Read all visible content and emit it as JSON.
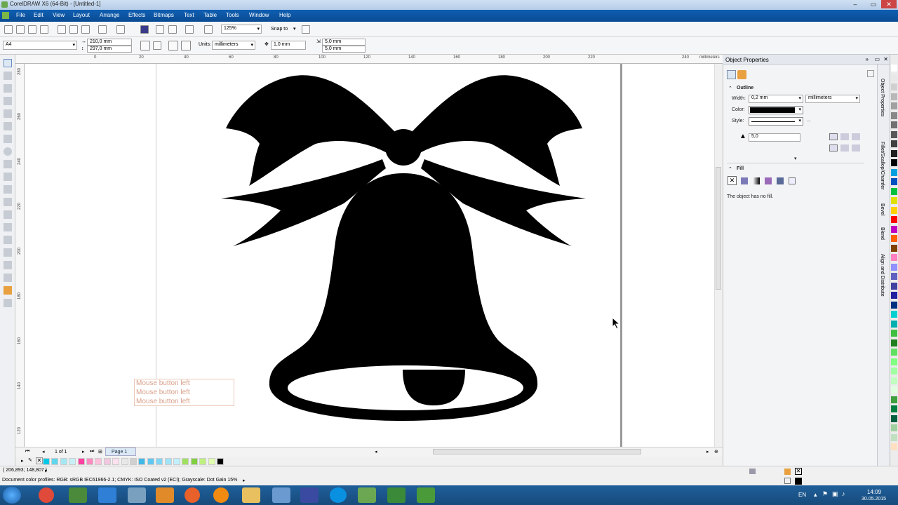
{
  "title": "CorelDRAW X6 (64-Bit) - [Untitled-1]",
  "menu": [
    "File",
    "Edit",
    "View",
    "Layout",
    "Arrange",
    "Effects",
    "Bitmaps",
    "Text",
    "Table",
    "Tools",
    "Window",
    "Help"
  ],
  "toolbar": {
    "zoom": "125%",
    "snap": "Snap to"
  },
  "propbar": {
    "page_size": "A4",
    "width": "210,0 mm",
    "height": "297,0 mm",
    "units_label": "Units:",
    "units": "millimeters",
    "nudge": "1,0 mm",
    "dup_x": "5,0 mm",
    "dup_y": "5,0 mm"
  },
  "ruler": {
    "unit": "millimeters",
    "top_ticks": [
      "0",
      "20",
      "40",
      "60",
      "80",
      "100",
      "120",
      "140",
      "160",
      "180",
      "200",
      "220",
      "240"
    ],
    "left_ticks": [
      "280",
      "260",
      "240",
      "220",
      "200",
      "180",
      "160",
      "140",
      "120"
    ]
  },
  "tooltip": [
    "Mouse button left",
    "Mouse button left",
    "Mouse button left"
  ],
  "pagenav": {
    "count": "1 of 1",
    "page_tab": "Page 1"
  },
  "status": {
    "coords": "( 206,893; 148,807 )",
    "profiles": "Document color profiles: RGB: sRGB IEC61966-2.1; CMYK: ISO Coated v2 (ECI); Grayscale: Dot Gain 15%"
  },
  "docker": {
    "title": "Object Properties",
    "outline": {
      "heading": "Outline",
      "width_label": "Width:",
      "width_value": "0,2 mm",
      "width_units": "millimeters",
      "color_label": "Color:",
      "style_label": "Style:",
      "miter": "5,0",
      "more": "..."
    },
    "fill": {
      "heading": "Fill",
      "message": "The object has no fill."
    },
    "side_tabs": [
      "Object Properties",
      "Fillet/Scallop/Chamfer",
      "Bevel",
      "Blend",
      "Align and Distribute"
    ]
  },
  "taskbar": {
    "lang": "EN",
    "time": "14:09",
    "date": "30.05.2015"
  },
  "colors": {
    "accent": "#0a4b92",
    "palette": [
      "#00c8e6",
      "#5fd7ee",
      "#a5e8f3",
      "#c8f0f7",
      "#ff3fa0",
      "#ff8ac0",
      "#ffc0dc",
      "#f2c7e0",
      "#ffe0ef",
      "#e8e8e8",
      "#d0d0d0",
      "#3fb8e8",
      "#5fc8f0",
      "#7fd6f5",
      "#9fe4fa",
      "#c0f0ff",
      "#a0e060",
      "#80d040",
      "#c0f080",
      "#e0ffb0",
      "#000000"
    ],
    "strip": [
      "#ffffff",
      "#e8e8e8",
      "#d0d0d0",
      "#b8b8b8",
      "#a0a0a0",
      "#888888",
      "#707070",
      "#585858",
      "#404040",
      "#202020",
      "#000000",
      "#00a0e0",
      "#0050c0",
      "#00c040",
      "#e0e000",
      "#ffd000",
      "#ff0000",
      "#c000c0",
      "#ff6000",
      "#804000",
      "#ff80c0",
      "#9090ff",
      "#6060c0",
      "#4040a0",
      "#2020a0",
      "#003080",
      "#00d0d0",
      "#00b0b0",
      "#40c040",
      "#208020",
      "#60e060",
      "#80ff80",
      "#a0ffa0",
      "#c0ffc0",
      "#e0ffe0",
      "#40a040",
      "#008040",
      "#006040",
      "#a0d0a0",
      "#c0e0c0",
      "#ffe0c0"
    ]
  }
}
